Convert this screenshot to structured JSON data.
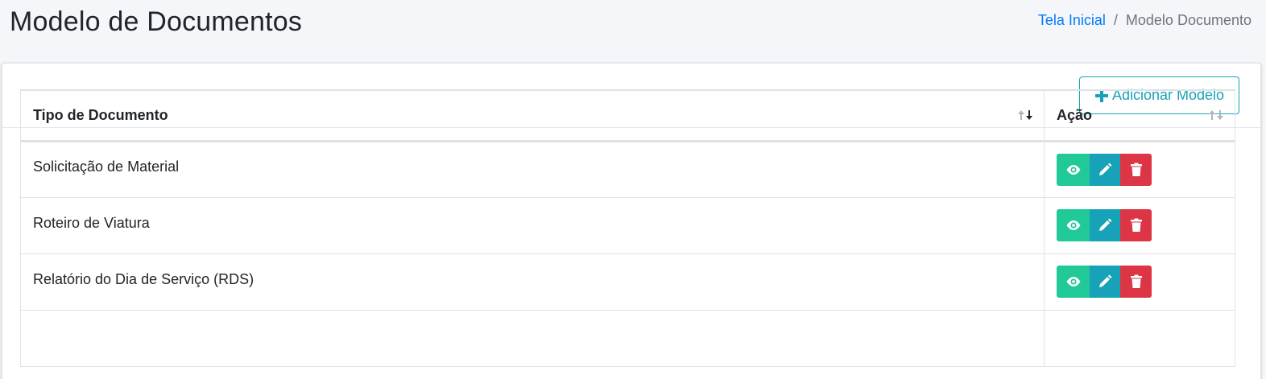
{
  "header": {
    "title": "Modelo de Documentos",
    "breadcrumb": {
      "home": "Tela Inicial",
      "separator": "/",
      "current": "Modelo Documento"
    }
  },
  "toolbar": {
    "add_label": "Adicionar Modelo"
  },
  "table": {
    "columns": [
      "Tipo de Documento",
      "Ação"
    ],
    "rows": [
      {
        "name": "Solicitação de Material"
      },
      {
        "name": "Roteiro de Viatura"
      },
      {
        "name": "Relatório do Dia de Serviço (RDS)"
      }
    ]
  },
  "colors": {
    "accent": "#17a2b8",
    "view": "#20c997",
    "edit": "#17a2b8",
    "delete": "#dc3545",
    "link": "#007bff"
  },
  "icons": {
    "add": "plus-icon",
    "view": "eye-icon",
    "edit": "pencil-icon",
    "delete": "trash-icon",
    "sort": "sort-icon"
  }
}
